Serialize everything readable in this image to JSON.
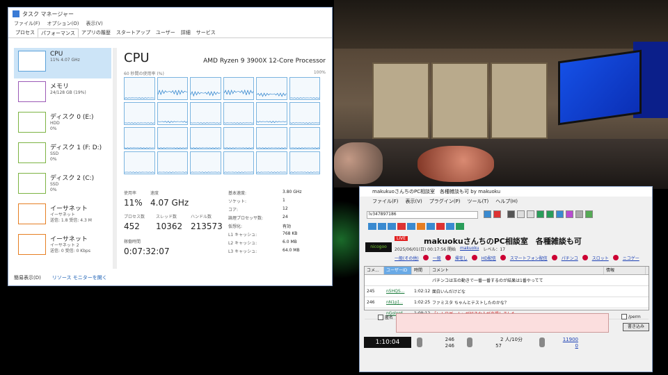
{
  "taskmgr": {
    "title": "タスク マネージャー",
    "menu": [
      "ファイル(F)",
      "オプション(O)",
      "表示(V)"
    ],
    "tabs": [
      "プロセス",
      "パフォーマンス",
      "アプリの履歴",
      "スタートアップ",
      "ユーザー",
      "詳細",
      "サービス"
    ],
    "active_tab": "パフォーマンス",
    "sidebar": [
      {
        "name": "CPU",
        "l1": "11% 4.07 GHz",
        "l2": ""
      },
      {
        "name": "メモリ",
        "l1": "24/128 GB (19%)",
        "l2": ""
      },
      {
        "name": "ディスク 0 (E:)",
        "l1": "HDD",
        "l2": "0%"
      },
      {
        "name": "ディスク 1 (F: D:)",
        "l1": "SSD",
        "l2": "0%"
      },
      {
        "name": "ディスク 2 (C:)",
        "l1": "SSD",
        "l2": "0%"
      },
      {
        "name": "イーサネット",
        "l1": "イーサネット",
        "l2": "送信: 1.8 受信: 4.3 M"
      },
      {
        "name": "イーサネット",
        "l1": "イーサネット 2",
        "l2": "送信: 0 受信: 0 Kbps"
      }
    ],
    "cpu_title": "CPU",
    "cpu_model": "AMD Ryzen 9 3900X 12-Core Processor",
    "util_label": "60 秒間の使用率 (%)",
    "util_max": "100%",
    "core_levels": [
      0.05,
      0.3,
      0.25,
      0.3,
      0.2,
      0.05,
      0.05,
      0.1,
      0.05,
      0.05,
      0.1,
      0.05,
      0.05,
      0.05,
      0.05,
      0.05,
      0.05,
      0.05,
      0.05,
      0.05,
      0.05,
      0.05,
      0.05,
      0.05
    ],
    "stats": {
      "usage_label": "使用率",
      "usage": "11%",
      "speed_label": "速度",
      "speed": "4.07 GHz",
      "proc_label": "プロセス数",
      "proc": "452",
      "thread_label": "スレッド数",
      "thread": "10362",
      "handle_label": "ハンドル数",
      "handle": "213573",
      "uptime_label": "稼働時間",
      "uptime": "0:07:32:07"
    },
    "specs": [
      {
        "k": "基本速度:",
        "v": "3.80 GHz"
      },
      {
        "k": "ソケット:",
        "v": "1"
      },
      {
        "k": "コア:",
        "v": "12"
      },
      {
        "k": "論理プロセッサ数:",
        "v": "24"
      },
      {
        "k": "仮想化:",
        "v": "有効"
      },
      {
        "k": "L1 キャッシュ:",
        "v": "768 KB"
      },
      {
        "k": "L2 キャッシュ:",
        "v": "6.0 MB"
      },
      {
        "k": "L3 キャッシュ:",
        "v": "64.0 MB"
      }
    ],
    "footer_simple": "簡易表示(D)",
    "footer_resmon": "リソース モニターを開く"
  },
  "nicolive": {
    "title": "makukuoさんちのPC相談室　各種雑談も可 by makuoku",
    "menu": [
      "ファイル(F)",
      "表示(V)",
      "プラグイン(P)",
      "ツール(T)",
      "ヘルプ(H)"
    ],
    "url": "lv347897186",
    "live_badge": "LIVE",
    "broadcast_title": "makuokuさんちのPC相談室　各種雑談も可",
    "date": "2025/06/01(日) 00:17:56 開始",
    "owner": "makuoku",
    "level": "レベル：17",
    "logo_text": "nicogoo",
    "tags": [
      "一般(その他)",
      "一般",
      "帰宅し",
      "HD配信",
      "スマートフォン配信",
      "パチンコ",
      "スロット",
      "ニコゲー"
    ],
    "columns": [
      "コメ...",
      "ユーザーID",
      "時間",
      "コメント",
      "情報"
    ],
    "comments": [
      {
        "no": "",
        "uid": "",
        "time": "",
        "text": "パチンコは玉の動きで一番一番するのが結果は1番やってて",
        "info": ""
      },
      {
        "no": "245",
        "uid": "n5HQS...",
        "time": "1:02:12",
        "text": "面白いんだけどな",
        "info": ""
      },
      {
        "no": "246",
        "uid": "nN1p]...",
        "time": "1:02:25",
        "text": "ファミスタ ちゃんとテストしたのかな？",
        "info": ""
      },
      {
        "no": "",
        "uid": "nGolerd",
        "time": "1:09:12",
        "text": "「レトロゲーム」が好きな人が来場しました",
        "info": ""
      }
    ],
    "anon_label": "匿名",
    "perm_label": "/perm",
    "send_label": "書き込み",
    "elapsed": "1:10:04",
    "comment_count": "246",
    "comment_count2": "246",
    "viewers": "2 人/10分",
    "viewers2": "57",
    "link1": "11900",
    "link2": "0"
  },
  "colors": {
    "accent": "#5aa0d8",
    "bg": "#000000",
    "comment_input": "#fbdede"
  }
}
